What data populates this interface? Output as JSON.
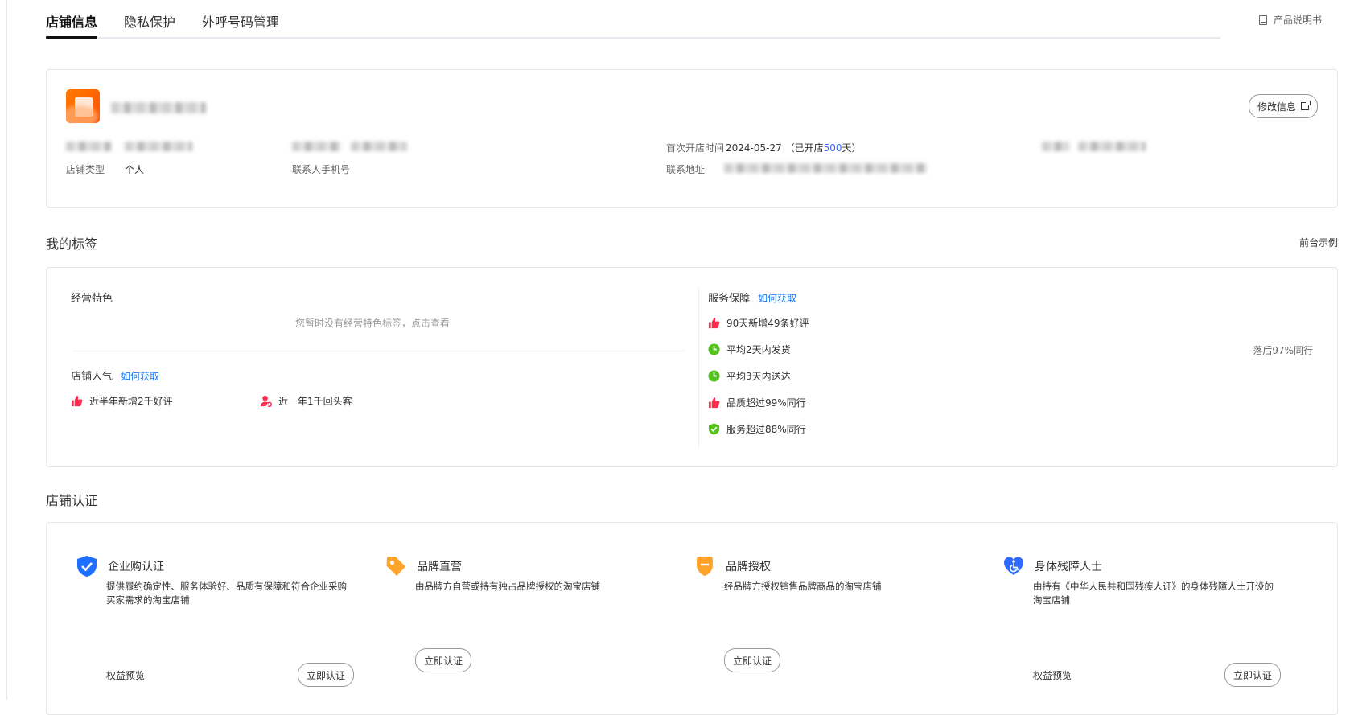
{
  "tabs": [
    {
      "label": "店铺信息",
      "active": true
    },
    {
      "label": "隐私保护",
      "active": false
    },
    {
      "label": "外呼号码管理",
      "active": false
    }
  ],
  "manual_link": "产品说明书",
  "shop_info": {
    "edit_button": "修改信息",
    "open_time_label": "首次开店时间",
    "open_time_date": "2024-05-27",
    "open_days_prefix": "（已开店",
    "open_days": "500",
    "open_days_suffix": "天）",
    "shop_type_label": "店铺类型",
    "shop_type_value": "个人",
    "contact_phone_label": "联系人手机号",
    "contact_address_label": "联系地址"
  },
  "tags_section": {
    "title": "我的标签",
    "demo_link": "前台示例",
    "business_feature": {
      "title": "经营特色",
      "empty_text": "您暂时没有经营特色标签，点击查看"
    },
    "popularity": {
      "title": "店铺人气",
      "how_link": "如何获取",
      "items": [
        "近半年新增2千好评",
        "近一年1千回头客"
      ]
    },
    "service": {
      "title": "服务保障",
      "how_link": "如何获取",
      "items": [
        {
          "icon": "thumbs-up-icon",
          "text": "90天新增49条好评"
        },
        {
          "icon": "clock-icon",
          "text": "平均2天内发货",
          "note": "落后97%同行"
        },
        {
          "icon": "clock-icon",
          "text": "平均3天内送达"
        },
        {
          "icon": "thumbs-up-icon",
          "text": "品质超过99%同行"
        },
        {
          "icon": "shield-check-icon",
          "text": "服务超过88%同行"
        }
      ]
    }
  },
  "cert_section": {
    "title": "店铺认证",
    "items": [
      {
        "title": "企业购认证",
        "desc": "提供履约确定性、服务体验好、品质有保障和符合企业采购买家需求的淘宝店铺",
        "perk": "权益预览",
        "button": "立即认证",
        "icon": "shield-check-icon"
      },
      {
        "title": "品牌直营",
        "desc": "由品牌方自营或持有独占品牌授权的淘宝店铺",
        "button": "立即认证",
        "icon": "tag-icon"
      },
      {
        "title": "品牌授权",
        "desc": "经品牌方授权销售品牌商品的淘宝店铺",
        "button": "立即认证",
        "icon": "badge-icon"
      },
      {
        "title": "身体残障人士",
        "desc": "由持有《中华人民共和国残疾人证》的身体残障人士开设的淘宝店铺",
        "perk": "权益预览",
        "button": "立即认证",
        "icon": "accessibility-heart-icon"
      }
    ]
  },
  "colors": {
    "accent_blue": "#3366ff",
    "link_blue": "#1a7cff",
    "red": "#ff2b4f",
    "green": "#52c41a",
    "orange": "#ff5000"
  }
}
